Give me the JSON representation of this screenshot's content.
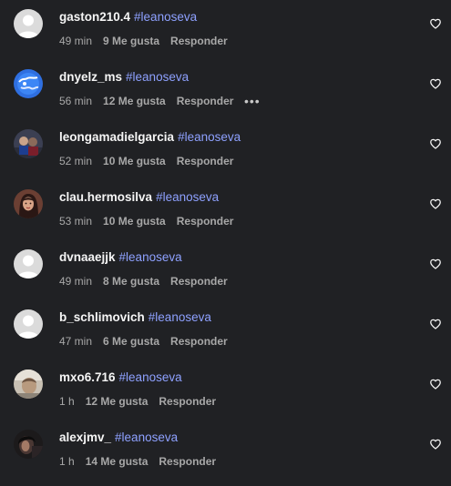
{
  "comments": [
    {
      "username": "gaston210.4",
      "hashtag": "#leanoseva",
      "time": "49 min",
      "likes": "9 Me gusta",
      "reply": "Responder",
      "avatar": "default-avatar",
      "liked": false,
      "more_options": ""
    },
    {
      "username": "dnyelz_ms",
      "hashtag": "#leanoseva",
      "time": "56 min",
      "likes": "12 Me gusta",
      "reply": "Responder",
      "avatar": "blue-globe-avatar",
      "liked": false,
      "more_options": "•••"
    },
    {
      "username": "leongamadielgarcia",
      "hashtag": "#leanoseva",
      "time": "52 min",
      "likes": "10 Me gusta",
      "reply": "Responder",
      "avatar": "photo-avatar-group",
      "liked": false,
      "more_options": ""
    },
    {
      "username": "clau.hermosilva",
      "hashtag": "#leanoseva",
      "time": "53 min",
      "likes": "10 Me gusta",
      "reply": "Responder",
      "avatar": "photo-avatar-woman",
      "liked": false,
      "more_options": ""
    },
    {
      "username": "dvnaaejjk",
      "hashtag": "#leanoseva",
      "time": "49 min",
      "likes": "8 Me gusta",
      "reply": "Responder",
      "avatar": "default-avatar",
      "liked": false,
      "more_options": ""
    },
    {
      "username": "b_schlimovich",
      "hashtag": "#leanoseva",
      "time": "47 min",
      "likes": "6 Me gusta",
      "reply": "Responder",
      "avatar": "default-avatar",
      "liked": false,
      "more_options": ""
    },
    {
      "username": "mxo6.716",
      "hashtag": "#leanoseva",
      "time": "1 h",
      "likes": "12 Me gusta",
      "reply": "Responder",
      "avatar": "photo-avatar-light",
      "liked": false,
      "more_options": ""
    },
    {
      "username": "alexjmv_",
      "hashtag": "#leanoseva",
      "time": "1 h",
      "likes": "14 Me gusta",
      "reply": "Responder",
      "avatar": "photo-avatar-dark",
      "liked": false,
      "more_options": ""
    }
  ],
  "colors": {
    "background": "#202124",
    "username": "#f5f5f5",
    "hashtag": "#8ea1ff",
    "meta": "#a8a8a8",
    "heart": "#f5f5f5"
  },
  "icons": {
    "like": "heart-outline-icon",
    "more": "more-options-icon"
  }
}
